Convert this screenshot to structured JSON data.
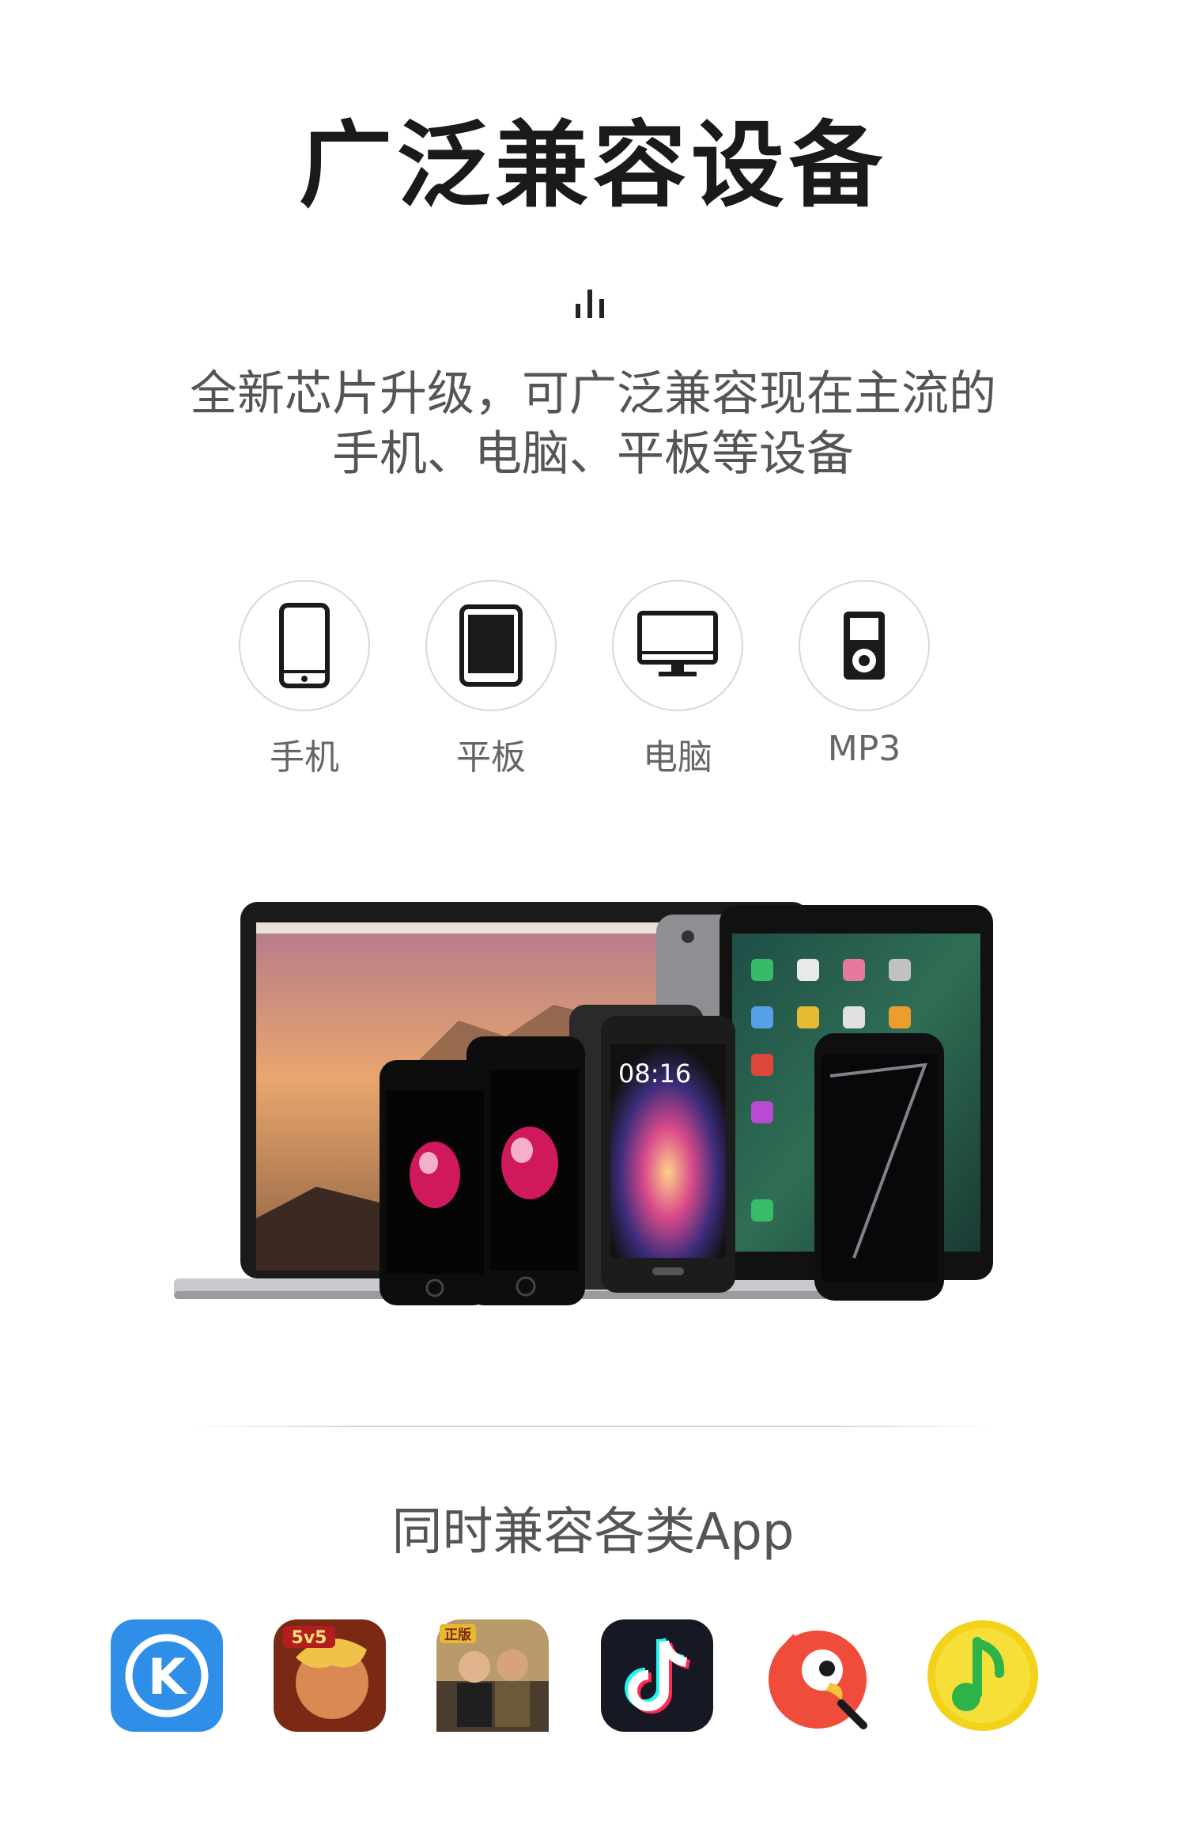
{
  "header": {
    "title": "广泛兼容设备",
    "subtitle_line1": "全新芯片升级，可广泛兼容现在主流的",
    "subtitle_line2": "手机、电脑、平板等设备"
  },
  "devices": [
    {
      "label": "手机",
      "icon": "phone-icon"
    },
    {
      "label": "平板",
      "icon": "tablet-icon"
    },
    {
      "label": "电脑",
      "icon": "monitor-icon"
    },
    {
      "label": "MP3",
      "icon": "mp3-player-icon"
    }
  ],
  "illustration": {
    "phone_clock": "08:16"
  },
  "apps": {
    "title": "同时兼容各类App",
    "items": [
      {
        "icon": "kugou-app-icon",
        "badge": "K",
        "color": "#2f8fe8"
      },
      {
        "icon": "honor-of-kings-app-icon",
        "badge": "5v5",
        "color": "#b8461e"
      },
      {
        "icon": "pubg-app-icon",
        "badge": "正版",
        "color": "#6b5b45"
      },
      {
        "icon": "tiktok-app-icon",
        "color": "#161823"
      },
      {
        "icon": "kuwo-app-icon",
        "color": "#f04c3c"
      },
      {
        "icon": "qq-music-app-icon",
        "color": "#f2d21b"
      }
    ]
  },
  "colors": {
    "title": "#1a1a1a",
    "subtitle": "#555555",
    "circle_border": "#d8d8d8",
    "icon_stroke": "#1a1a1a"
  }
}
